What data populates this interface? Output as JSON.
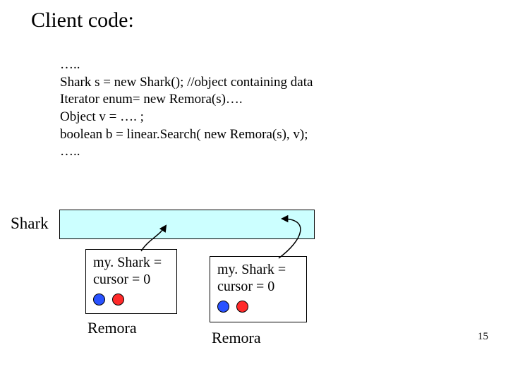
{
  "title": "Client code:",
  "code": {
    "l1": "…..",
    "l2": "Shark s = new Shark(); //object containing data",
    "l3": "Iterator enum= new Remora(s)….",
    "l4": "Object v = …. ;",
    "l5": "boolean b = linear.Search( new Remora(s), v);",
    "l6": "….."
  },
  "labels": {
    "shark": "Shark",
    "remora1": "Remora",
    "remora2": "Remora"
  },
  "remora_text": {
    "line_a": "my. Shark =",
    "line_b": "cursor = 0"
  },
  "page_number": "15"
}
